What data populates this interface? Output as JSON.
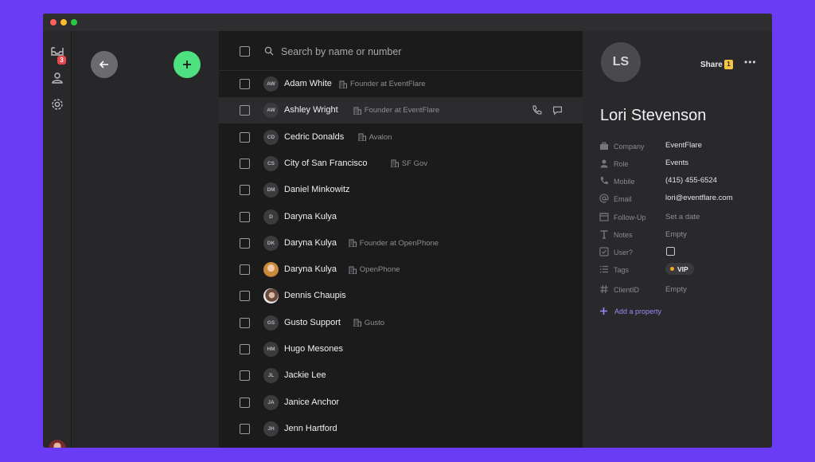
{
  "window": {
    "traffic_lights": {
      "close": "#ff5f57",
      "minimize": "#febc2e",
      "zoom": "#28c840"
    }
  },
  "rail": {
    "inbox_badge": "3",
    "icons": [
      "inbox-icon",
      "contacts-icon",
      "gear-icon"
    ]
  },
  "left_panel": {
    "back_icon": "arrow-left-icon",
    "add_icon": "plus-icon",
    "accent": "#4ee17f"
  },
  "search": {
    "placeholder": "Search by name or number"
  },
  "contacts": [
    {
      "initials": "AW",
      "name": "Adam White",
      "company": "Founder at EventFlare"
    },
    {
      "initials": "AW",
      "name": "Ashley Wright",
      "company": "Founder at EventFlare"
    },
    {
      "initials": "CD",
      "name": "Cedric Donalds",
      "company": "Avalon"
    },
    {
      "initials": "CS",
      "name": "City of San Francisco",
      "company": "SF Gov"
    },
    {
      "initials": "DM",
      "name": "Daniel Minkowitz",
      "company": ""
    },
    {
      "initials": "D",
      "name": "Daryna Kulya",
      "company": ""
    },
    {
      "initials": "DK",
      "name": "Daryna Kulya",
      "company": "Founder at OpenPhone"
    },
    {
      "initials": "",
      "name": "Daryna Kulya",
      "company": "OpenPhone"
    },
    {
      "initials": "",
      "name": "Dennis Chaupis",
      "company": ""
    },
    {
      "initials": "GS",
      "name": "Gusto Support",
      "company": "Gusto"
    },
    {
      "initials": "HM",
      "name": "Hugo Mesones",
      "company": ""
    },
    {
      "initials": "JL",
      "name": "Jackie Lee",
      "company": ""
    },
    {
      "initials": "JA",
      "name": "Janice Anchor",
      "company": ""
    },
    {
      "initials": "JH",
      "name": "Jenn Hartford",
      "company": ""
    }
  ],
  "detail": {
    "initials": "LS",
    "name": "Lori Stevenson",
    "share_label": "Share",
    "share_count": "1",
    "properties": {
      "company": {
        "label": "Company",
        "value": "EventFlare",
        "icon": "briefcase-icon"
      },
      "role": {
        "label": "Role",
        "value": "Events",
        "icon": "person-icon"
      },
      "mobile": {
        "label": "Mobile",
        "value": "(415) 455-6524",
        "icon": "phone-icon"
      },
      "email": {
        "label": "Email",
        "value": "lori@eventflare.com",
        "icon": "at-icon"
      },
      "follow_up": {
        "label": "Follow-Up",
        "value": "Set a date",
        "icon": "calendar-icon"
      },
      "notes": {
        "label": "Notes",
        "value": "Empty",
        "icon": "text-icon"
      },
      "user": {
        "label": "User?",
        "checked": false,
        "icon": "checkbox-icon"
      },
      "tags": {
        "label": "Tags",
        "value": "VIP",
        "tag_color": "#f5a623",
        "icon": "list-icon"
      },
      "client_id": {
        "label": "ClientID",
        "value": "Empty",
        "icon": "hash-icon"
      }
    },
    "add_property_label": "Add a property"
  }
}
